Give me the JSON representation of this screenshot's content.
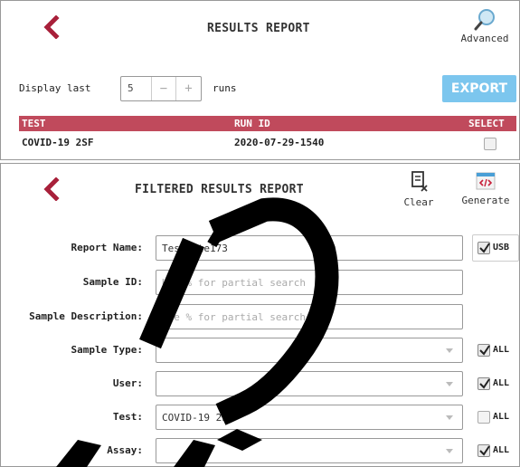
{
  "results_report": {
    "title": "RESULTS REPORT",
    "advanced_label": "Advanced",
    "display_last_label": "Display last",
    "runs_value": "5",
    "minus_label": "−",
    "plus_label": "+",
    "runs_label": "runs",
    "export_label": "EXPORT",
    "table": {
      "headers": {
        "test": "TEST",
        "run_id": "RUN ID",
        "select": "SELECT"
      },
      "rows": [
        {
          "test": "COVID-19 2SF",
          "run_id": "2020-07-29-1540",
          "selected": false
        }
      ]
    },
    "colors": {
      "accent": "#a8203a",
      "header_bg": "#c04a5c",
      "export_bg": "#7cc6ee"
    }
  },
  "filtered_report": {
    "title": "FILTERED RESULTS REPORT",
    "clear_label": "Clear",
    "generate_label": "Generate",
    "fields": {
      "report_name": {
        "label": "Report Name:",
        "value": "TestSite173",
        "checkbox_label": "USB",
        "checked": true
      },
      "sample_id": {
        "label": "Sample ID:",
        "placeholder": "Use % for partial search"
      },
      "sample_description": {
        "label": "Sample Description:",
        "placeholder": "Use % for partial search"
      },
      "sample_type": {
        "label": "Sample Type:",
        "value": "",
        "checkbox_label": "ALL",
        "checked": true
      },
      "user": {
        "label": "User:",
        "value": "",
        "checkbox_label": "ALL",
        "checked": true
      },
      "test": {
        "label": "Test:",
        "value": "COVID-19 2SF",
        "checkbox_label": "ALL",
        "checked": false
      },
      "assay": {
        "label": "Assay:",
        "value": "",
        "checkbox_label": "ALL",
        "checked": true
      }
    }
  }
}
